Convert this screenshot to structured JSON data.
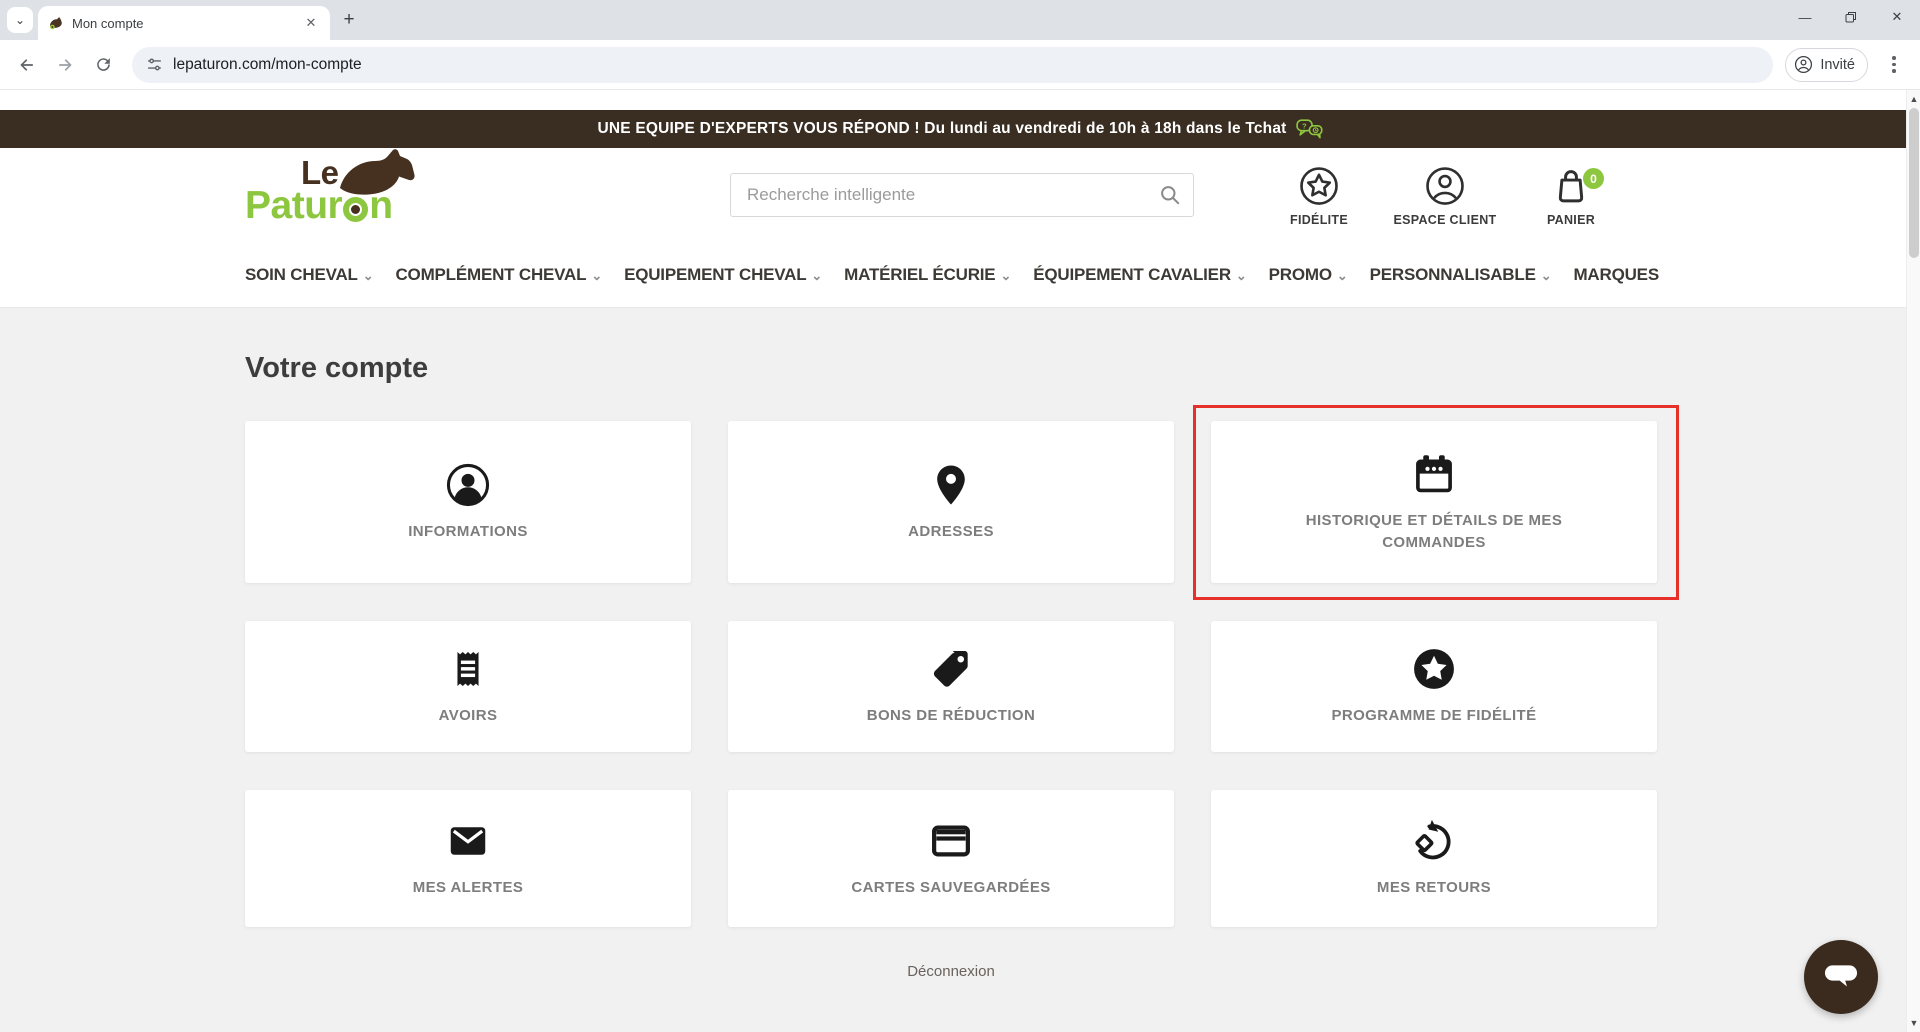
{
  "browser": {
    "tab_title": "Mon compte",
    "url": "lepaturon.com/mon-compte",
    "profile_label": "Invité"
  },
  "banner": {
    "text": "UNE EQUIPE D'EXPERTS VOUS RÉPOND ! Du lundi au vendredi de 10h à 18h dans le Tchat"
  },
  "header": {
    "logo": {
      "prefix": "Le",
      "main_pre": "Patur",
      "main_post": "n",
      "full": "Le PaturOn"
    },
    "search_placeholder": "Recherche intelligente",
    "quick_links": [
      {
        "label": "FIDÉLITE",
        "icon": "star-circle-icon"
      },
      {
        "label": "ESPACE CLIENT",
        "icon": "user-circle-icon"
      },
      {
        "label": "PANIER",
        "icon": "basket-icon",
        "badge": "0"
      }
    ]
  },
  "nav": {
    "items": [
      {
        "label": "SOIN CHEVAL",
        "has_dropdown": true
      },
      {
        "label": "COMPLÉMENT CHEVAL",
        "has_dropdown": true
      },
      {
        "label": "EQUIPEMENT CHEVAL",
        "has_dropdown": true
      },
      {
        "label": "MATÉRIEL ÉCURIE",
        "has_dropdown": true
      },
      {
        "label": "ÉQUIPEMENT CAVALIER",
        "has_dropdown": true
      },
      {
        "label": "PROMO",
        "has_dropdown": true
      },
      {
        "label": "PERSONNALISABLE",
        "has_dropdown": true
      },
      {
        "label": "MARQUES",
        "has_dropdown": false
      }
    ]
  },
  "account": {
    "title": "Votre compte",
    "cards": [
      {
        "label": "INFORMATIONS",
        "icon": "user-icon",
        "highlighted": false
      },
      {
        "label": "ADRESSES",
        "icon": "map-pin-icon",
        "highlighted": false
      },
      {
        "label": "HISTORIQUE ET DÉTAILS DE MES COMMANDES",
        "icon": "calendar-icon",
        "highlighted": true
      },
      {
        "label": "AVOIRS",
        "icon": "receipt-icon",
        "highlighted": false
      },
      {
        "label": "BONS DE RÉDUCTION",
        "icon": "tag-icon",
        "highlighted": false
      },
      {
        "label": "PROGRAMME DE FIDÉLITÉ",
        "icon": "star-badge-icon",
        "highlighted": false
      },
      {
        "label": "MES ALERTES",
        "icon": "envelope-icon",
        "highlighted": false
      },
      {
        "label": "CARTES SAUVEGARDÉES",
        "icon": "credit-card-icon",
        "highlighted": false
      },
      {
        "label": "MES RETOURS",
        "icon": "return-icon",
        "highlighted": false
      }
    ],
    "logout_label": "Déconnexion"
  },
  "colors": {
    "accent": "#8dc63f",
    "brand": "#3a2d21",
    "highlight": "#e8302a",
    "label": "#7d7d7d"
  }
}
